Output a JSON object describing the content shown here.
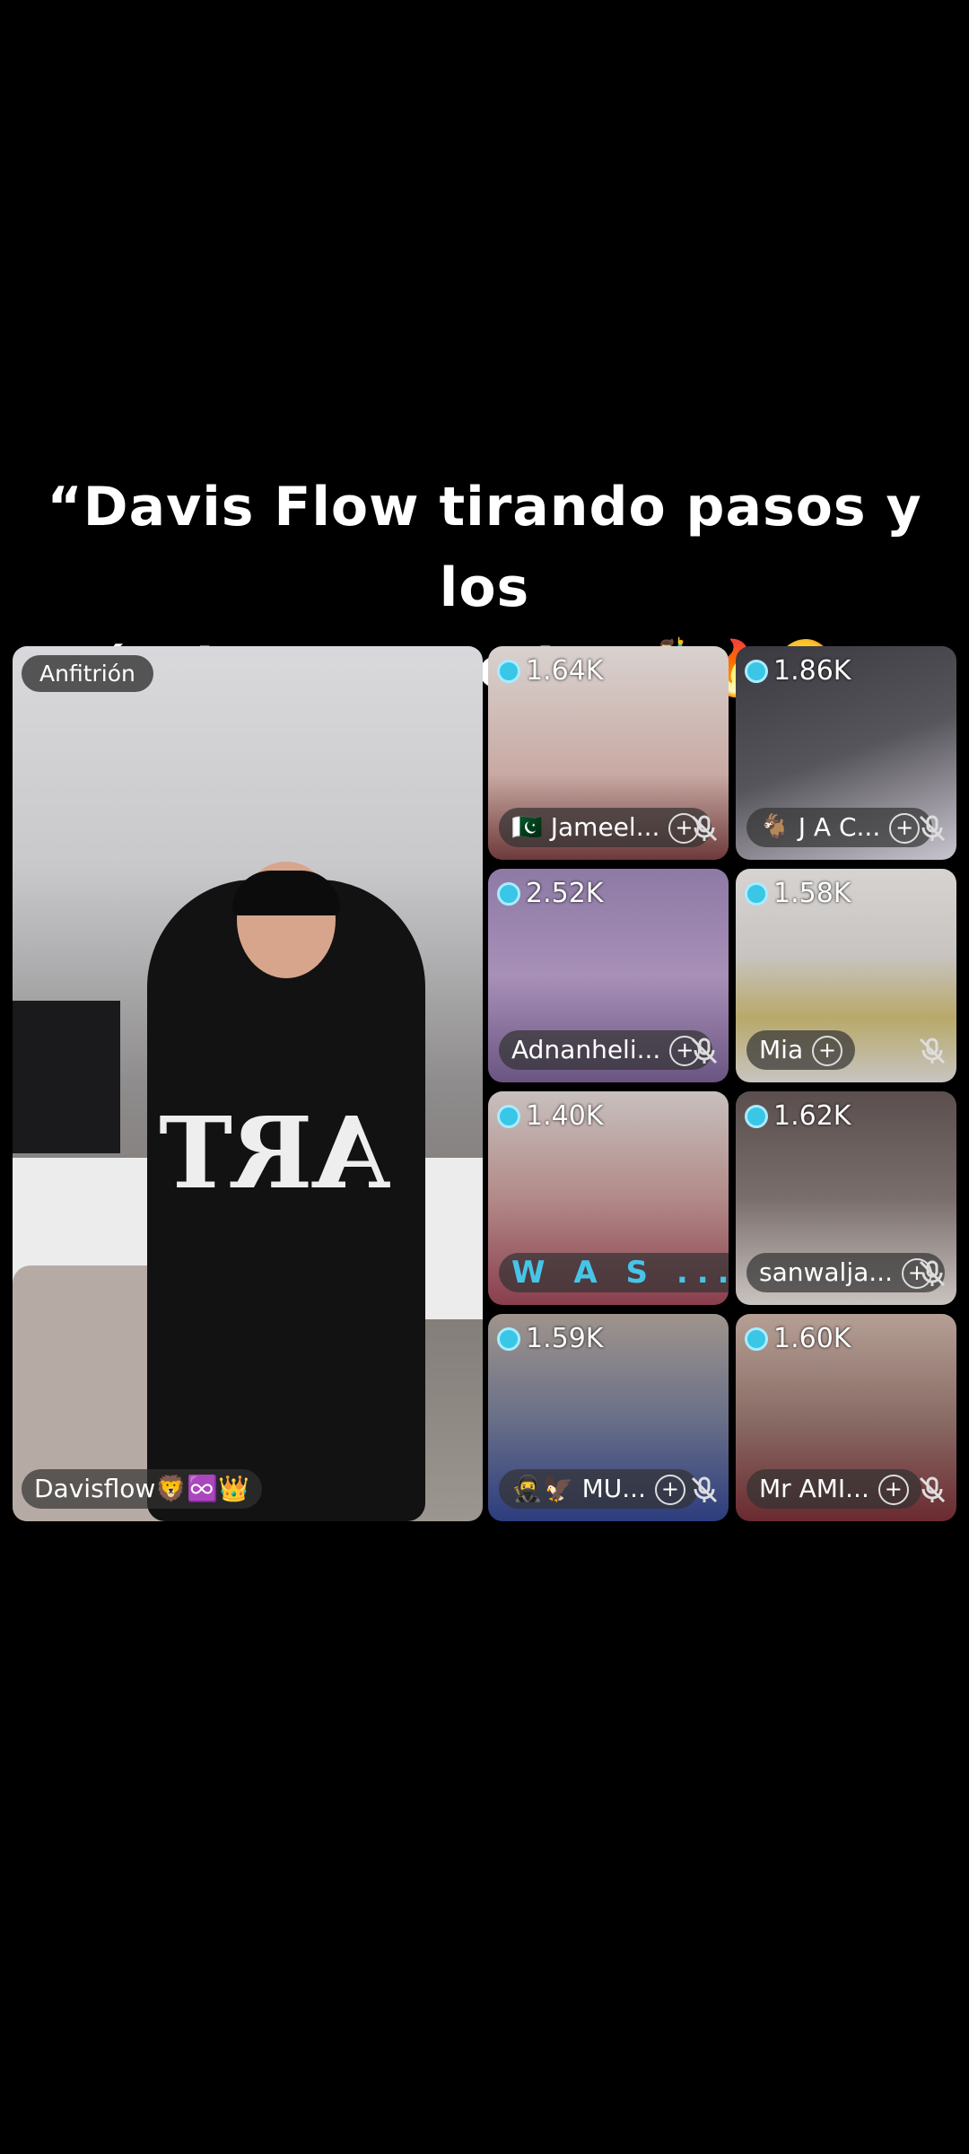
{
  "caption": {
    "line1": "“Davis Flow tirando pasos y los",
    "line2": "árabes en modo: 🕺🔥🤣”"
  },
  "host": {
    "badge": "Anfitrión",
    "name": "Davisflow🦁♾️👑",
    "shirt_text": "ART"
  },
  "guests": [
    {
      "count": "1.64K",
      "name": "🇵🇰 Jameel...",
      "muted": true,
      "bg": "#c9a9a3"
    },
    {
      "count": "1.86K",
      "name": "🐐 J A C...",
      "muted": true,
      "bg": "#57555c"
    },
    {
      "count": "2.52K",
      "name": "Adnanheli...",
      "muted": true,
      "bg": "#a890b8"
    },
    {
      "count": "1.58K",
      "name": "Mia",
      "muted": true,
      "bg": "#c8c4c2"
    },
    {
      "count": "1.40K",
      "name": "W A S ...",
      "muted": false,
      "bg": "#b28a88"
    },
    {
      "count": "1.62K",
      "name": "sanwalja...",
      "muted": true,
      "bg": "#7a6e6c"
    },
    {
      "count": "1.59K",
      "name": "🥷🦅 MU...",
      "muted": true,
      "bg": "#6a7088"
    },
    {
      "count": "1.60K",
      "name": "Mr AMI...",
      "muted": true,
      "bg": "#8a6d66"
    }
  ]
}
